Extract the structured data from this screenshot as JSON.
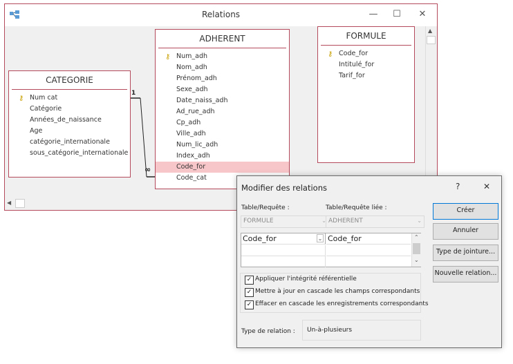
{
  "relations_window": {
    "title": "Relations",
    "minimize_glyph": "—",
    "maximize_glyph": "☐",
    "close_glyph": "✕",
    "tables": {
      "categorie": {
        "name": "CATEGORIE",
        "fields": [
          "Num cat",
          "Catégorie",
          "Années_de_naissance",
          "Age",
          "catégorie_internationale",
          "sous_catégorie_internationale"
        ],
        "primary_key": "Num cat"
      },
      "adherent": {
        "name": "ADHERENT",
        "fields": [
          "Num_adh",
          "Nom_adh",
          "Prénom_adh",
          "Sexe_adh",
          "Date_naiss_adh",
          "Ad_rue_adh",
          "Cp_adh",
          "Ville_adh",
          "Num_lic_adh",
          "Index_adh",
          "Code_for",
          "Code_cat"
        ],
        "primary_key": "Num_adh",
        "selected_field": "Code_for"
      },
      "formule": {
        "name": "FORMULE",
        "fields": [
          "Code_for",
          "Intitulé_for",
          "Tarif_for"
        ],
        "primary_key": "Code_for"
      }
    },
    "relationship": {
      "one_label": "1",
      "many_label": "∞"
    }
  },
  "dialog": {
    "title": "Modifier des relations",
    "help_glyph": "?",
    "close_glyph": "✕",
    "table_label": "Table/Requête :",
    "related_label": "Table/Requête liée :",
    "table_value": "FORMULE",
    "related_value": "ADHERENT",
    "grid_left": "Code_for",
    "grid_right": "Code_for",
    "checkboxes": [
      {
        "label": "Appliquer l'intégrité référentielle",
        "checked": true
      },
      {
        "label": "Mettre à jour en cascade les champs correspondants",
        "checked": true
      },
      {
        "label": "Effacer en cascade les enregistrements correspondants",
        "checked": true
      }
    ],
    "relation_type_label": "Type de relation :",
    "relation_type_value": "Un-à-plusieurs",
    "buttons": {
      "create": "Créer",
      "cancel": "Annuler",
      "join_type": "Type de jointure...",
      "new_relation": "Nouvelle relation..."
    }
  }
}
